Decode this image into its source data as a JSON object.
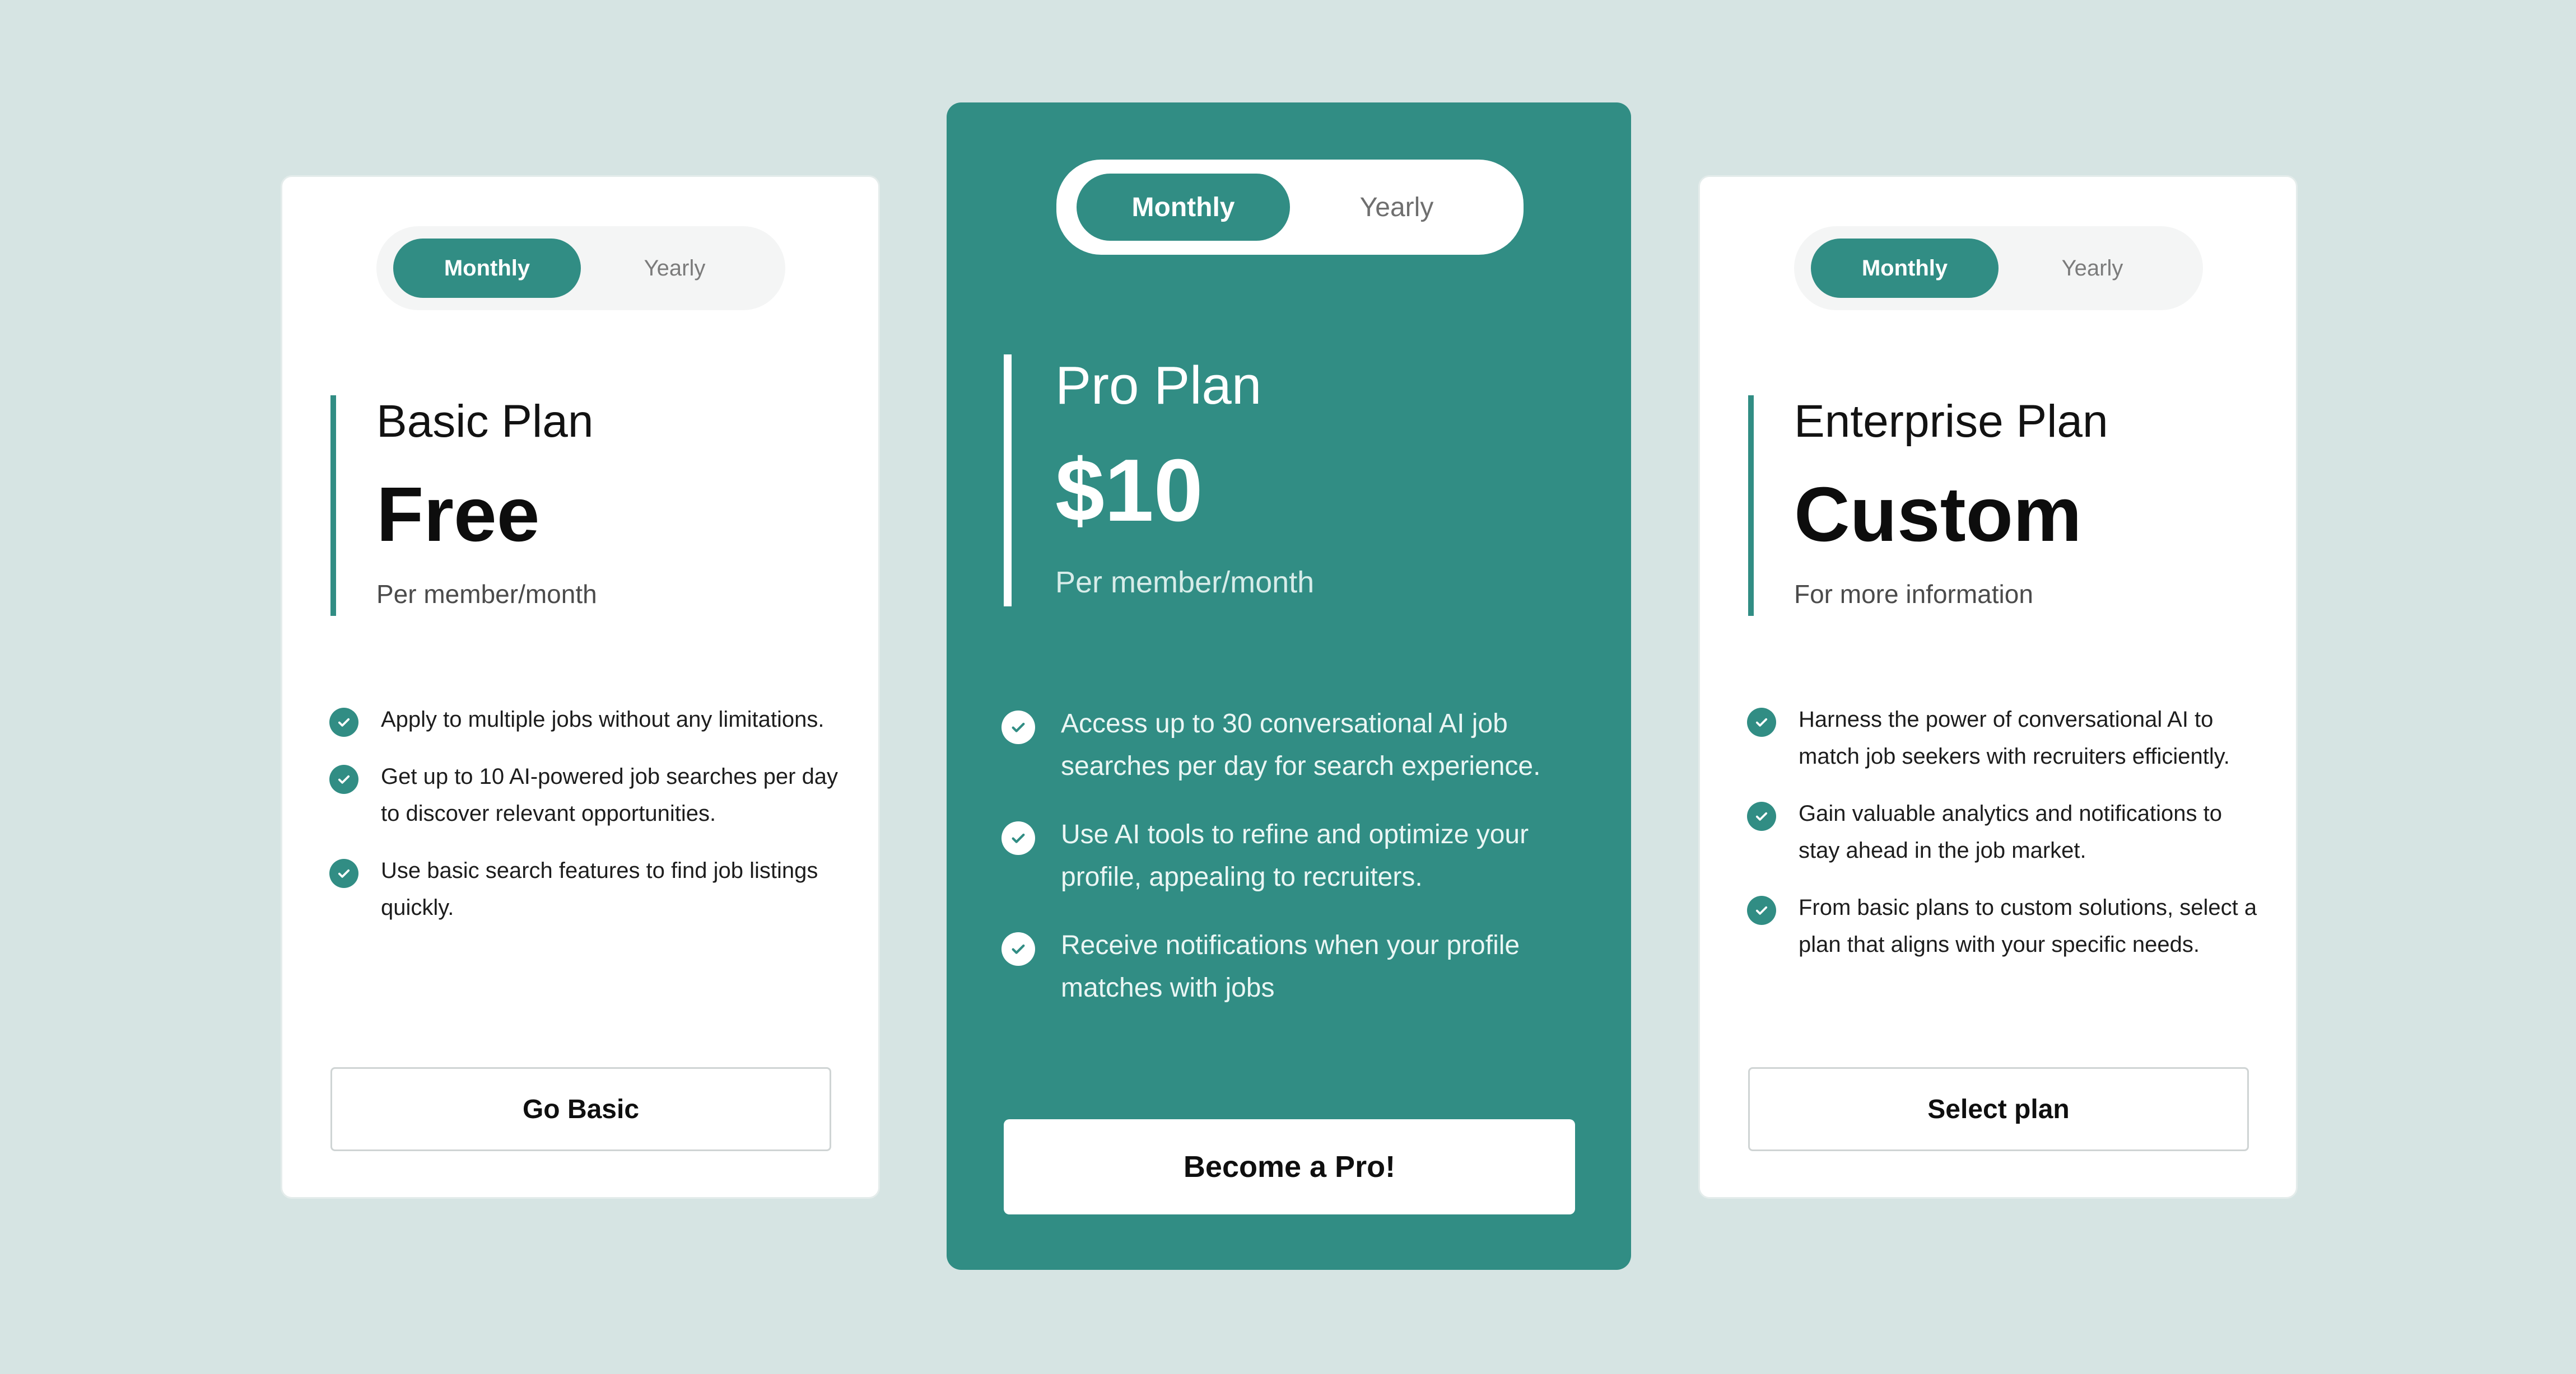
{
  "colors": {
    "background": "#d6e4e3",
    "accent": "#318d84",
    "card": "#ffffff"
  },
  "plans": [
    {
      "toggle": {
        "monthly": "Monthly",
        "yearly": "Yearly",
        "selected": "Monthly"
      },
      "name": "Basic Plan",
      "price": "Free",
      "price_note": "Per member/month",
      "features": [
        "Apply to multiple jobs without any limitations.",
        "Get up to 10 AI-powered job searches per day to discover relevant opportunities.",
        "Use basic search features to find job listings quickly."
      ],
      "cta": "Go Basic"
    },
    {
      "toggle": {
        "monthly": "Monthly",
        "yearly": "Yearly",
        "selected": "Monthly"
      },
      "name": "Pro Plan",
      "price": "$10",
      "price_note": "Per member/month",
      "features": [
        "Access up to 30 conversational AI job searches per day for search experience.",
        "Use AI tools to refine and optimize your profile, appealing to recruiters.",
        "Receive notifications when your profile matches with jobs"
      ],
      "cta": "Become a Pro!"
    },
    {
      "toggle": {
        "monthly": "Monthly",
        "yearly": "Yearly",
        "selected": "Monthly"
      },
      "name": "Enterprise Plan",
      "price": "Custom",
      "price_note": "For more information",
      "features": [
        "Harness the power of conversational AI to match job seekers with recruiters efficiently.",
        "Gain valuable analytics and notifications to stay ahead in the job market.",
        "From basic plans to custom solutions, select a plan that aligns with your specific needs."
      ],
      "cta": "Select plan"
    }
  ],
  "icons": {
    "feature": "check-circle-icon"
  }
}
